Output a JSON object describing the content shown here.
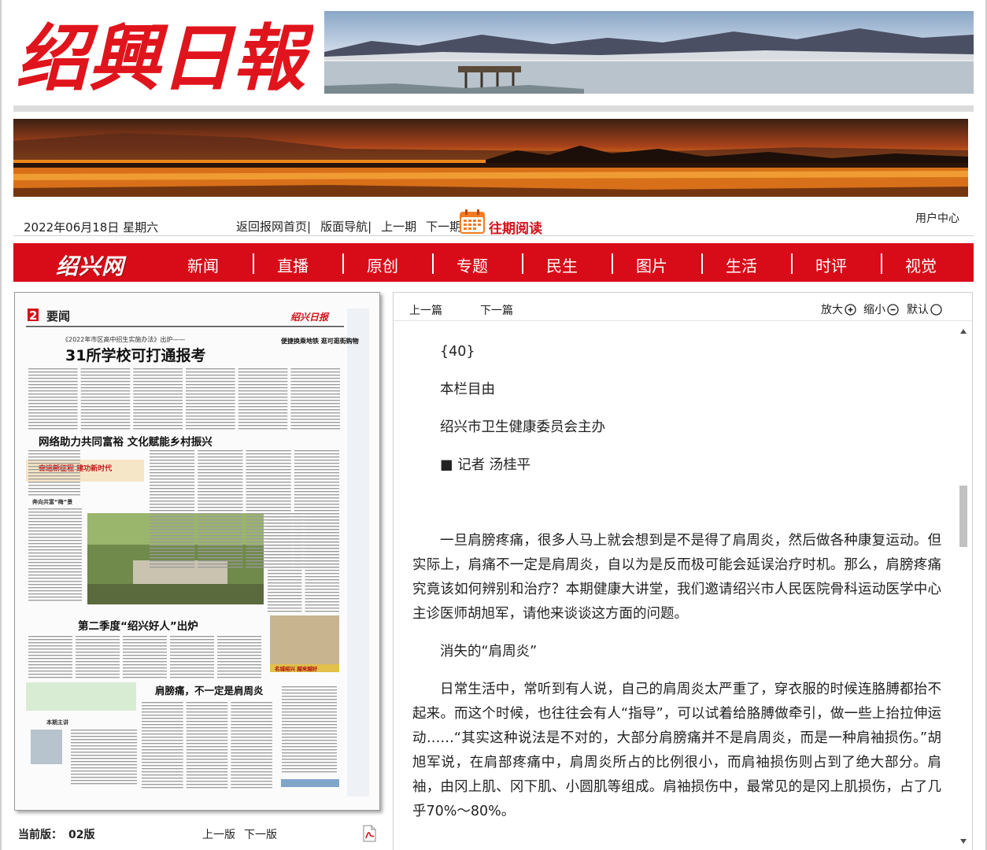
{
  "masthead": {
    "logo_text": "绍興日報"
  },
  "info_bar": {
    "date": "2022年06月18日 星期六",
    "links": [
      {
        "label": "返回报网首页|"
      },
      {
        "label": "版面导航|"
      },
      {
        "label": "上一期"
      },
      {
        "label": "下一期|"
      }
    ],
    "past_reading": "往期阅读",
    "user_center": "用户中心"
  },
  "nav": {
    "logo": "绍兴网",
    "items": [
      {
        "label": "新闻"
      },
      {
        "label": "直播"
      },
      {
        "label": "原创"
      },
      {
        "label": "专题"
      },
      {
        "label": "民生"
      },
      {
        "label": "图片"
      },
      {
        "label": "生活"
      },
      {
        "label": "时评"
      },
      {
        "label": "视觉"
      }
    ]
  },
  "paper": {
    "page_no": "2",
    "section": "要闻",
    "paper_logo": "绍兴日报",
    "subhead": "《2022年市区高中招生实施办法》出炉——",
    "headline": "31所学校可打通报考",
    "side_head": "便捷换乘地铁 逛可逛街购物",
    "head2": "网络助力共同富裕  文化赋能乡村振兴",
    "banner1": "奋进新征程  建功新时代",
    "small_head": "奔向共富“梅”景",
    "head3": "第二季度“绍兴好人”出炉",
    "head4": "肩膀痛，不一定是肩周炎",
    "column_box": "本期主讲",
    "tag": "名城绍兴  越来越好",
    "footer": {
      "current_label": "当前版：",
      "current_value": "02版",
      "prev": "上一版",
      "next": "下一版"
    }
  },
  "article": {
    "toolbar": {
      "prev": "上一篇",
      "next": "下一篇",
      "zoom_in": "放大",
      "zoom_out": "缩小",
      "default": "默认"
    },
    "paragraphs": [
      "{40}",
      "本栏目由",
      "绍兴市卫生健康委员会主办",
      "■ 记者 汤桂平",
      "一旦肩膀疼痛，很多人马上就会想到是不是得了肩周炎，然后做各种康复运动。但实际上，肩痛不一定是肩周炎，自以为是反而极可能会延误治疗时机。那么，肩膀疼痛究竟该如何辨别和治疗？本期健康大讲堂，我们邀请绍兴市人民医院骨科运动医学中心主诊医师胡旭军，请他来谈谈这方面的问题。",
      "消失的“肩周炎”",
      "日常生活中，常听到有人说，自己的肩周炎太严重了，穿衣服的时候连胳膊都抬不起来。而这个时候，也往往会有人“指导”，可以试着给胳膊做牵引，做一些上抬拉伸运动……“其实这种说法是不对的，大部分肩膀痛并不是肩周炎，而是一种肩袖损伤。”胡旭军说，在肩部疼痛中，肩周炎所占的比例很小，而肩袖损伤则占到了绝大部分。肩袖，由冈上肌、冈下肌、小圆肌等组成。肩袖损伤中，最常见的是冈上肌损伤，占了几乎70%～80%。"
    ]
  },
  "colors": {
    "nav_red": "#d80c18",
    "past_red": "#d3111a"
  }
}
